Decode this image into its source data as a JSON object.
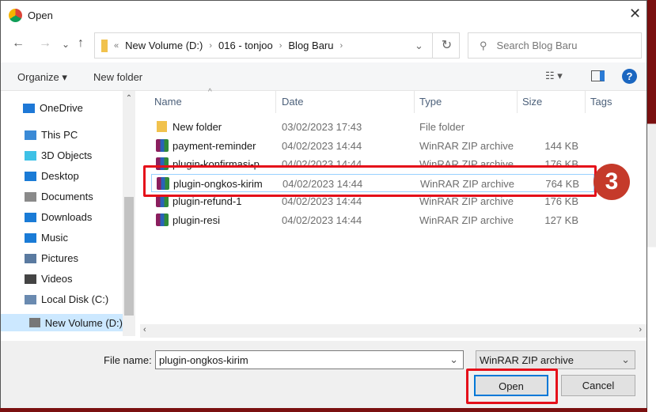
{
  "window": {
    "title": "Open",
    "close": "✕"
  },
  "nav": {
    "back": "←",
    "forward": "→",
    "recent": "⌄",
    "up": "↑"
  },
  "address": {
    "prefix": "«",
    "crumbs": [
      "New Volume (D:)",
      "016 - tonjoo",
      "Blog Baru"
    ],
    "dropdown": "⌄",
    "refresh": "↻"
  },
  "search": {
    "placeholder": "Search Blog Baru"
  },
  "toolbar": {
    "organize": "Organize ▾",
    "new_folder": "New folder",
    "view": "☷ ▾",
    "help": "?"
  },
  "sidebar": {
    "items": [
      {
        "label": "OneDrive",
        "icon": "cloud-icon",
        "color": "#1e78d6"
      },
      {
        "label": "This PC",
        "icon": "computer-icon",
        "color": "#3a8ad6"
      },
      {
        "label": "3D Objects",
        "icon": "cube-icon",
        "color": "#3ec1e6"
      },
      {
        "label": "Desktop",
        "icon": "desktop-icon",
        "color": "#1a7bd6"
      },
      {
        "label": "Documents",
        "icon": "document-icon",
        "color": "#8a8a8a"
      },
      {
        "label": "Downloads",
        "icon": "download-icon",
        "color": "#1a7bd6"
      },
      {
        "label": "Music",
        "icon": "music-icon",
        "color": "#1a7bd6"
      },
      {
        "label": "Pictures",
        "icon": "pictures-icon",
        "color": "#5a7aa0"
      },
      {
        "label": "Videos",
        "icon": "video-icon",
        "color": "#444"
      },
      {
        "label": "Local Disk (C:)",
        "icon": "drive-icon",
        "color": "#6a8ab0"
      },
      {
        "label": "New Volume (D:)",
        "icon": "drive-icon",
        "color": "#777",
        "selected": true
      }
    ]
  },
  "columns": [
    "Name",
    "Date",
    "Type",
    "Size",
    "Tags"
  ],
  "files": [
    {
      "name": "New folder",
      "date": "03/02/2023 17:43",
      "type": "File folder",
      "size": "",
      "icon": "folder-icon"
    },
    {
      "name": "payment-reminder",
      "date": "04/02/2023 14:44",
      "type": "WinRAR ZIP archive",
      "size": "144 KB",
      "icon": "winrar-icon"
    },
    {
      "name": "plugin-konfirmasi-p...",
      "date": "04/02/2023 14:44",
      "type": "WinRAR ZIP archive",
      "size": "176 KB",
      "icon": "winrar-icon"
    },
    {
      "name": "plugin-ongkos-kirim",
      "date": "04/02/2023 14:44",
      "type": "WinRAR ZIP archive",
      "size": "764 KB",
      "icon": "winrar-icon",
      "selected": true
    },
    {
      "name": "plugin-refund-1",
      "date": "04/02/2023 14:44",
      "type": "WinRAR ZIP archive",
      "size": "176 KB",
      "icon": "winrar-icon"
    },
    {
      "name": "plugin-resi",
      "date": "04/02/2023 14:44",
      "type": "WinRAR ZIP archive",
      "size": "127 KB",
      "icon": "winrar-icon"
    }
  ],
  "footer": {
    "file_name_label": "File name:",
    "file_name_value": "plugin-ongkos-kirim",
    "filter": "WinRAR ZIP archive",
    "open": "Open",
    "cancel": "Cancel"
  },
  "annotation": {
    "step": "3",
    "color": "#e5101a"
  }
}
